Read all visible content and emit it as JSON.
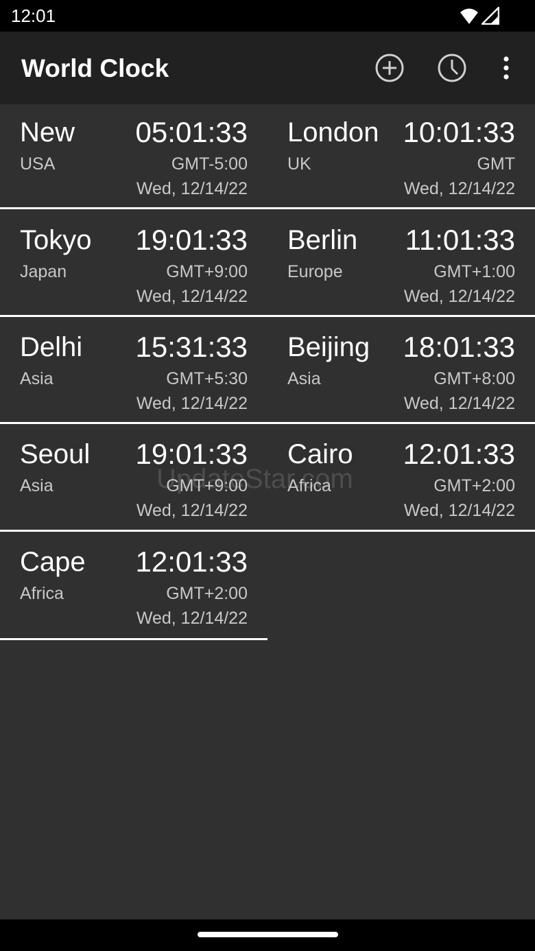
{
  "status_bar": {
    "time": "12:01",
    "icons": [
      "wifi-icon",
      "cell-signal-icon"
    ]
  },
  "app_bar": {
    "title": "World Clock",
    "actions": [
      "add-circle-icon",
      "clock-icon",
      "more-vert-icon"
    ]
  },
  "clocks": [
    {
      "city": "New",
      "region": "USA",
      "time": "05:01:33",
      "offset": "GMT-5:00",
      "date": "Wed, 12/14/22"
    },
    {
      "city": "London",
      "region": "UK",
      "time": "10:01:33",
      "offset": "GMT",
      "date": "Wed, 12/14/22"
    },
    {
      "city": "Tokyo",
      "region": "Japan",
      "time": "19:01:33",
      "offset": "GMT+9:00",
      "date": "Wed, 12/14/22"
    },
    {
      "city": "Berlin",
      "region": "Europe",
      "time": "11:01:33",
      "offset": "GMT+1:00",
      "date": "Wed, 12/14/22"
    },
    {
      "city": "Delhi",
      "region": "Asia",
      "time": "15:31:33",
      "offset": "GMT+5:30",
      "date": "Wed, 12/14/22"
    },
    {
      "city": "Beijing",
      "region": "Asia",
      "time": "18:01:33",
      "offset": "GMT+8:00",
      "date": "Wed, 12/14/22"
    },
    {
      "city": "Seoul",
      "region": "Asia",
      "time": "19:01:33",
      "offset": "GMT+9:00",
      "date": "Wed, 12/14/22"
    },
    {
      "city": "Cairo",
      "region": "Africa",
      "time": "12:01:33",
      "offset": "GMT+2:00",
      "date": "Wed, 12/14/22"
    },
    {
      "city": "Cape",
      "region": "Africa",
      "time": "12:01:33",
      "offset": "GMT+2:00",
      "date": "Wed, 12/14/22"
    }
  ],
  "watermark": "UpdateStar.com",
  "colors": {
    "background": "#303030",
    "app_bar": "#212121",
    "divider": "#ffffff",
    "secondary_text": "#c8c8c8"
  }
}
